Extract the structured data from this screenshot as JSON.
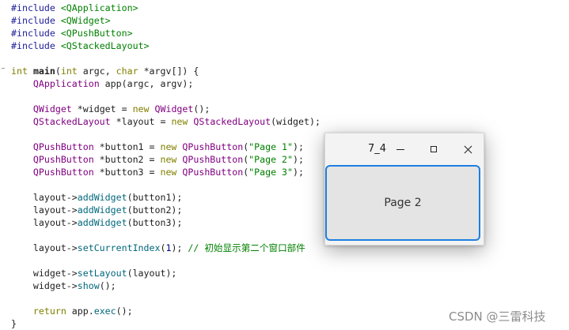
{
  "editor": {
    "lines": [
      [
        {
          "t": "#include",
          "c": "pre"
        },
        {
          "t": " "
        },
        {
          "t": "<QApplication>",
          "c": "inc"
        }
      ],
      [
        {
          "t": "#include",
          "c": "pre"
        },
        {
          "t": " "
        },
        {
          "t": "<QWidget>",
          "c": "inc"
        }
      ],
      [
        {
          "t": "#include",
          "c": "pre"
        },
        {
          "t": " "
        },
        {
          "t": "<QPushButton>",
          "c": "inc"
        }
      ],
      [
        {
          "t": "#include",
          "c": "pre"
        },
        {
          "t": " "
        },
        {
          "t": "<QStackedLayout>",
          "c": "inc"
        }
      ],
      [],
      [
        {
          "t": "int",
          "c": "kw"
        },
        {
          "t": " "
        },
        {
          "t": "main",
          "c": "bold"
        },
        {
          "t": "("
        },
        {
          "t": "int",
          "c": "kw"
        },
        {
          "t": " argc, "
        },
        {
          "t": "char",
          "c": "kw"
        },
        {
          "t": " *argv[]) {"
        }
      ],
      [
        {
          "t": "    "
        },
        {
          "t": "QApplication",
          "c": "type"
        },
        {
          "t": " app(argc, argv);"
        }
      ],
      [],
      [
        {
          "t": "    "
        },
        {
          "t": "QWidget",
          "c": "type"
        },
        {
          "t": " *widget = "
        },
        {
          "t": "new",
          "c": "kw"
        },
        {
          "t": " "
        },
        {
          "t": "QWidget",
          "c": "type"
        },
        {
          "t": "();"
        }
      ],
      [
        {
          "t": "    "
        },
        {
          "t": "QStackedLayout",
          "c": "type"
        },
        {
          "t": " *layout = "
        },
        {
          "t": "new",
          "c": "kw"
        },
        {
          "t": " "
        },
        {
          "t": "QStackedLayout",
          "c": "type"
        },
        {
          "t": "(widget);"
        }
      ],
      [],
      [
        {
          "t": "    "
        },
        {
          "t": "QPushButton",
          "c": "type"
        },
        {
          "t": " *button1 = "
        },
        {
          "t": "new",
          "c": "kw"
        },
        {
          "t": " "
        },
        {
          "t": "QPushButton",
          "c": "type"
        },
        {
          "t": "("
        },
        {
          "t": "\"Page 1\"",
          "c": "str"
        },
        {
          "t": ");"
        }
      ],
      [
        {
          "t": "    "
        },
        {
          "t": "QPushButton",
          "c": "type"
        },
        {
          "t": " *button2 = "
        },
        {
          "t": "new",
          "c": "kw"
        },
        {
          "t": " "
        },
        {
          "t": "QPushButton",
          "c": "type"
        },
        {
          "t": "("
        },
        {
          "t": "\"Page 2\"",
          "c": "str"
        },
        {
          "t": ");"
        }
      ],
      [
        {
          "t": "    "
        },
        {
          "t": "QPushButton",
          "c": "type"
        },
        {
          "t": " *button3 = "
        },
        {
          "t": "new",
          "c": "kw"
        },
        {
          "t": " "
        },
        {
          "t": "QPushButton",
          "c": "type"
        },
        {
          "t": "("
        },
        {
          "t": "\"Page 3\"",
          "c": "str"
        },
        {
          "t": ");"
        }
      ],
      [],
      [
        {
          "t": "    layout->"
        },
        {
          "t": "addWidget",
          "c": "fn"
        },
        {
          "t": "(button1);"
        }
      ],
      [
        {
          "t": "    layout->"
        },
        {
          "t": "addWidget",
          "c": "fn"
        },
        {
          "t": "(button2);"
        }
      ],
      [
        {
          "t": "    layout->"
        },
        {
          "t": "addWidget",
          "c": "fn"
        },
        {
          "t": "(button3);"
        }
      ],
      [],
      [
        {
          "t": "    layout->"
        },
        {
          "t": "setCurrentIndex",
          "c": "fn"
        },
        {
          "t": "("
        },
        {
          "t": "1",
          "c": "num"
        },
        {
          "t": "); "
        },
        {
          "t": "// 初始显示第二个窗口部件",
          "c": "cmt"
        }
      ],
      [],
      [
        {
          "t": "    widget->"
        },
        {
          "t": "setLayout",
          "c": "fn"
        },
        {
          "t": "(layout);"
        }
      ],
      [
        {
          "t": "    widget->"
        },
        {
          "t": "show",
          "c": "fn"
        },
        {
          "t": "();"
        }
      ],
      [],
      [
        {
          "t": "    "
        },
        {
          "t": "return",
          "c": "kw"
        },
        {
          "t": " app."
        },
        {
          "t": "exec",
          "c": "fn"
        },
        {
          "t": "();"
        }
      ],
      [
        {
          "t": "}"
        }
      ]
    ]
  },
  "window": {
    "title": "7_4",
    "button_label": "Page 2"
  },
  "watermark": "CSDN @三雷科技",
  "colors": {
    "preprocessor": "#1c1c9a",
    "include_path": "#008000",
    "type": "#800080",
    "keyword": "#808000",
    "function": "#00677c",
    "string": "#008000",
    "comment": "#008000",
    "focus_border": "#1e7fe0"
  },
  "icons": [
    "minimize-icon",
    "maximize-icon",
    "close-icon"
  ]
}
